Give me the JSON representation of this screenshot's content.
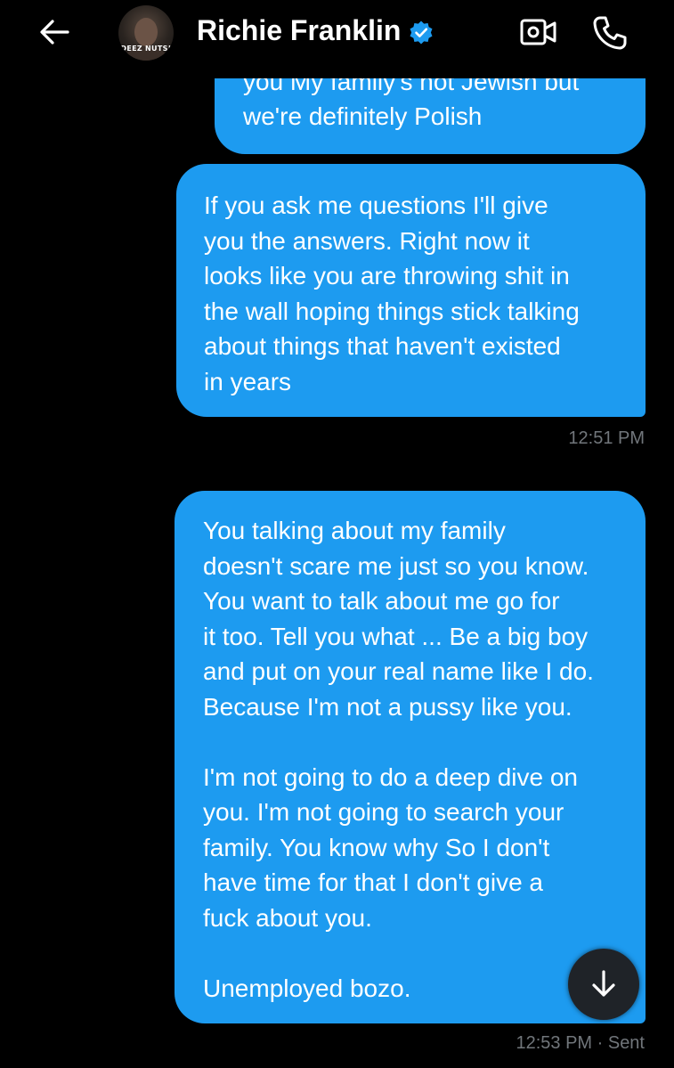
{
  "header": {
    "contact_name": "Richie Franklin",
    "avatar_text": "DEEZ NUTS!",
    "verified": true
  },
  "messages": [
    {
      "clipped_top": "you My family's not Jewish but",
      "text": "we're definitely Polish",
      "direction": "sent"
    },
    {
      "text": "If you ask me questions I'll give\nyou the answers. Right now it\nlooks like you are throwing shit in\nthe wall hoping things stick talking\nabout things that haven't existed\nin years",
      "timestamp": "12:51 PM",
      "direction": "sent"
    },
    {
      "text": "You talking about my family\ndoesn't scare me just so you know.\nYou want to talk about me go for\nit too. Tell you what ... Be a big boy\nand put on your real name like I do.\nBecause I'm not a pussy like you.\n\nI'm not going to do a deep dive on\nyou. I'm not going to search your\nfamily. You know why So I don't\nhave time for that I don't give a\nfuck about you.\n\nUnemployed bozo.",
      "timestamp": "12:53 PM · Sent",
      "direction": "sent"
    }
  ],
  "colors": {
    "background": "#000000",
    "bubble": "#1d9bf0",
    "timestamp": "#71767b",
    "verified_badge": "#1d9bf0"
  },
  "icons": [
    "back-arrow-icon",
    "verified-badge-icon",
    "video-call-icon",
    "phone-icon",
    "arrow-down-icon"
  ]
}
